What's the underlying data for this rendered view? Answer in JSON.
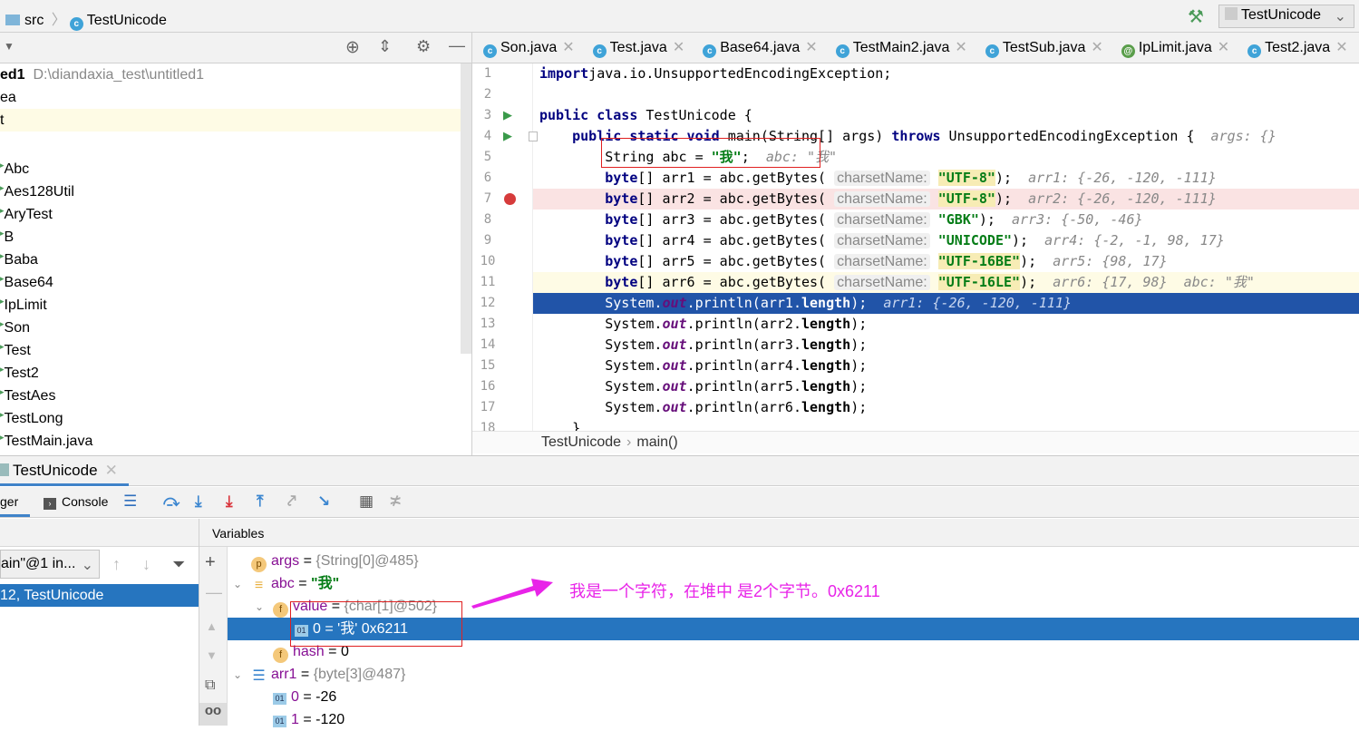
{
  "topbar": {
    "breadcrumb": [
      "src",
      "TestUnicode"
    ],
    "run_config": "TestUnicode"
  },
  "project": {
    "root_name": "ed1",
    "root_path": "D:\\diandaxia_test\\untitled1",
    "items": [
      "ea",
      "t",
      "",
      "Abc",
      "Aes128Util",
      "AryTest",
      "B",
      "Baba",
      "Base64",
      "IpLimit",
      "Son",
      "Test",
      "Test2",
      "TestAes",
      "TestLong",
      "TestMain.java"
    ]
  },
  "editor": {
    "tabs": [
      {
        "label": "Son.java",
        "icon": "c"
      },
      {
        "label": "Test.java",
        "icon": "c"
      },
      {
        "label": "Base64.java",
        "icon": "c"
      },
      {
        "label": "TestMain2.java",
        "icon": "c"
      },
      {
        "label": "TestSub.java",
        "icon": "c"
      },
      {
        "label": "IpLimit.java",
        "icon": "@"
      },
      {
        "label": "Test2.java",
        "icon": "c"
      }
    ],
    "lines": [
      {
        "n": "1",
        "tokens": [
          [
            "kw",
            "import"
          ],
          [
            "",
            "java.io.UnsupportedEncodingException;"
          ]
        ]
      },
      {
        "n": "2",
        "tokens": []
      },
      {
        "n": "3",
        "tokens": [
          [
            "kw",
            "public class"
          ],
          [
            "",
            " TestUnicode {"
          ]
        ]
      },
      {
        "n": "4",
        "tokens": [
          [
            "",
            "    "
          ],
          [
            "kw",
            "public static void"
          ],
          [
            "",
            " main(String[] args) "
          ],
          [
            "kw",
            "throws"
          ],
          [
            "",
            " UnsupportedEncodingException {  "
          ],
          [
            "inl",
            "args: {}"
          ]
        ]
      },
      {
        "n": "5",
        "tokens": [
          [
            "",
            "        String abc = "
          ],
          [
            "str",
            "\"我\""
          ],
          [
            "",
            ";  "
          ],
          [
            "inl",
            "abc: \"我\""
          ]
        ]
      },
      {
        "n": "6",
        "tokens": [
          [
            "",
            "        "
          ],
          [
            "kw",
            "byte"
          ],
          [
            "",
            "[] arr1 = abc.getBytes( "
          ],
          [
            "hint",
            "charsetName:"
          ],
          [
            "",
            " "
          ],
          [
            "str strhl",
            "\"UTF-8\""
          ],
          [
            "",
            ");  "
          ],
          [
            "inl",
            "arr1: {-26, -120, -111}"
          ]
        ]
      },
      {
        "n": "7",
        "tokens": [
          [
            "",
            "        "
          ],
          [
            "kw",
            "byte"
          ],
          [
            "",
            "[] arr2 = abc.getBytes( "
          ],
          [
            "hint",
            "charsetName:"
          ],
          [
            "",
            " "
          ],
          [
            "str strhl",
            "\"UTF-8\""
          ],
          [
            "",
            ");  "
          ],
          [
            "inl",
            "arr2: {-26, -120, -111}"
          ]
        ]
      },
      {
        "n": "8",
        "tokens": [
          [
            "",
            "        "
          ],
          [
            "kw",
            "byte"
          ],
          [
            "",
            "[] arr3 = abc.getBytes( "
          ],
          [
            "hint",
            "charsetName:"
          ],
          [
            "",
            " "
          ],
          [
            "str",
            "\"GBK\""
          ],
          [
            "",
            ");  "
          ],
          [
            "inl",
            "arr3: {-50, -46}"
          ]
        ]
      },
      {
        "n": "9",
        "tokens": [
          [
            "",
            "        "
          ],
          [
            "kw",
            "byte"
          ],
          [
            "",
            "[] arr4 = abc.getBytes( "
          ],
          [
            "hint",
            "charsetName:"
          ],
          [
            "",
            " "
          ],
          [
            "str",
            "\"UNICODE\""
          ],
          [
            "",
            ");  "
          ],
          [
            "inl",
            "arr4: {-2, -1, 98, 17}"
          ]
        ]
      },
      {
        "n": "10",
        "tokens": [
          [
            "",
            "        "
          ],
          [
            "kw",
            "byte"
          ],
          [
            "",
            "[] arr5 = abc.getBytes( "
          ],
          [
            "hint",
            "charsetName:"
          ],
          [
            "",
            " "
          ],
          [
            "str strhl",
            "\"UTF-16BE\""
          ],
          [
            "",
            ");  "
          ],
          [
            "inl",
            "arr5: {98, 17}"
          ]
        ]
      },
      {
        "n": "11",
        "tokens": [
          [
            "",
            "        "
          ],
          [
            "kw",
            "byte"
          ],
          [
            "",
            "[] arr6 = abc.getBytes( "
          ],
          [
            "hint",
            "charsetName:"
          ],
          [
            "",
            " "
          ],
          [
            "str strhl",
            "\"UTF-16LE\""
          ],
          [
            "",
            ");  "
          ],
          [
            "inl",
            "arr6: {17, 98}  abc: \"我\""
          ]
        ]
      },
      {
        "n": "12",
        "tokens": [
          [
            "",
            "        System."
          ],
          [
            "fld",
            "out"
          ],
          [
            "",
            ".println(arr1."
          ],
          [
            "mbold",
            "length"
          ],
          [
            "",
            ");  "
          ],
          [
            "inl",
            "arr1: {-26, -120, -111}"
          ]
        ]
      },
      {
        "n": "13",
        "tokens": [
          [
            "",
            "        System."
          ],
          [
            "fld",
            "out"
          ],
          [
            "",
            ".println(arr2."
          ],
          [
            "mbold",
            "length"
          ],
          [
            "",
            ");"
          ]
        ]
      },
      {
        "n": "14",
        "tokens": [
          [
            "",
            "        System."
          ],
          [
            "fld",
            "out"
          ],
          [
            "",
            ".println(arr3."
          ],
          [
            "mbold",
            "length"
          ],
          [
            "",
            ");"
          ]
        ]
      },
      {
        "n": "15",
        "tokens": [
          [
            "",
            "        System."
          ],
          [
            "fld",
            "out"
          ],
          [
            "",
            ".println(arr4."
          ],
          [
            "mbold",
            "length"
          ],
          [
            "",
            ");"
          ]
        ]
      },
      {
        "n": "16",
        "tokens": [
          [
            "",
            "        System."
          ],
          [
            "fld",
            "out"
          ],
          [
            "",
            ".println(arr5."
          ],
          [
            "mbold",
            "length"
          ],
          [
            "",
            ");"
          ]
        ]
      },
      {
        "n": "17",
        "tokens": [
          [
            "",
            "        System."
          ],
          [
            "fld",
            "out"
          ],
          [
            "",
            ".println(arr6."
          ],
          [
            "mbold",
            "length"
          ],
          [
            "",
            ");"
          ]
        ]
      },
      {
        "n": "18",
        "tokens": [
          [
            "",
            "    }"
          ]
        ]
      }
    ],
    "breadcrumb": [
      "TestUnicode",
      "main()"
    ]
  },
  "debug": {
    "tab": "TestUnicode",
    "debugger_tab": "ger",
    "console_tab": "Console",
    "thread": "ain\"@1 in...",
    "frame": "12, TestUnicode",
    "variables_header": "Variables",
    "variables": [
      {
        "indent": 0,
        "chev": "",
        "badge": "p",
        "name": "args",
        "value": "{String[0]@485}"
      },
      {
        "indent": 0,
        "chev": "v",
        "badge": "≡",
        "name": "abc",
        "value": "\"我\"",
        "str": true
      },
      {
        "indent": 1,
        "chev": "v",
        "badge": "f",
        "name": "value",
        "value": "{char[1]@502}"
      },
      {
        "indent": 2,
        "chev": "",
        "badge": "01",
        "name": "0",
        "value": "'我' 0x6211",
        "selected": true
      },
      {
        "indent": 1,
        "chev": "",
        "badge": "f",
        "name": "hash",
        "value": "0",
        "plain": true
      },
      {
        "indent": 0,
        "chev": "v",
        "badge": "arr",
        "name": "arr1",
        "value": "{byte[3]@487}"
      },
      {
        "indent": 1,
        "chev": "",
        "badge": "01",
        "name": "0",
        "value": "-26",
        "plain": true
      },
      {
        "indent": 1,
        "chev": "",
        "badge": "01",
        "name": "1",
        "value": "-120",
        "plain": true
      }
    ]
  },
  "annotation": {
    "text": "我是一个字符，在堆中 是2个字节。0x6211",
    "color": "#e824e8"
  },
  "colors": {
    "selection": "#2675bf",
    "exec_line": "#2154a8",
    "breakpoint_line": "#fae3e3",
    "caret_line": "#fefbe5"
  }
}
